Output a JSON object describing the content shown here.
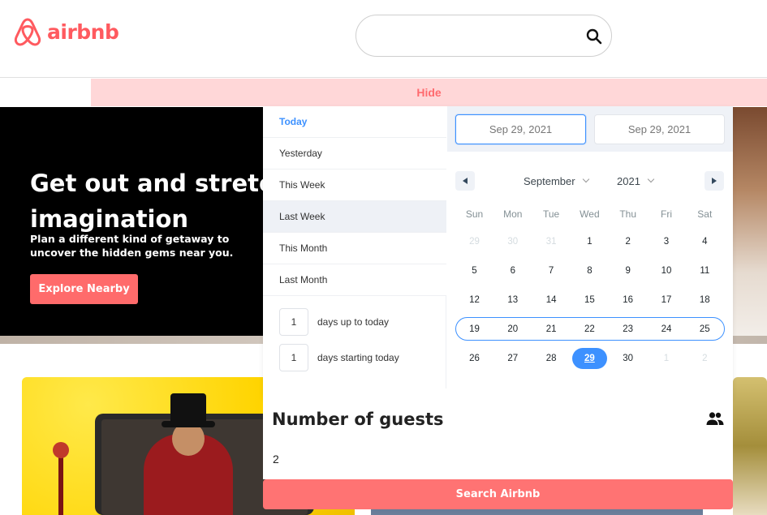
{
  "brand": {
    "name": "airbnb",
    "color": "#ff5a5f",
    "logo_icon": "airbnb-belo-icon"
  },
  "search": {
    "value": "",
    "icon": "search-icon"
  },
  "hide_bar": {
    "label": "Hide"
  },
  "hero": {
    "title": "Get out and stretch your imagination",
    "subtitle": "Plan a different kind of getaway to uncover the hidden gems near you.",
    "button_label": "Explore Nearby"
  },
  "datepicker": {
    "static_ranges": [
      "Today",
      "Yesterday",
      "This Week",
      "Last Week",
      "This Month",
      "Last Month"
    ],
    "active_range": "Today",
    "hovered_range": "Last Week",
    "input_ranges": [
      {
        "value": "1",
        "label": "days up to today"
      },
      {
        "value": "1",
        "label": "days starting today"
      }
    ],
    "start_date": "Sep 29, 2021",
    "end_date": "Sep 29, 2021",
    "month": "September",
    "year": "2021",
    "weekdays": [
      "Sun",
      "Mon",
      "Tue",
      "Wed",
      "Thu",
      "Fri",
      "Sat"
    ],
    "weeks": [
      [
        "29",
        "30",
        "31",
        "1",
        "2",
        "3",
        "4"
      ],
      [
        "5",
        "6",
        "7",
        "8",
        "9",
        "10",
        "11"
      ],
      [
        "12",
        "13",
        "14",
        "15",
        "16",
        "17",
        "18"
      ],
      [
        "19",
        "20",
        "21",
        "22",
        "23",
        "24",
        "25"
      ],
      [
        "26",
        "27",
        "28",
        "29",
        "30",
        "1",
        "2"
      ]
    ],
    "selected_day": "29",
    "accent_color": "#3d91ff"
  },
  "guests": {
    "title": "Number of guests",
    "icon": "people-icon",
    "value": "2"
  },
  "search_button": {
    "label": "Search Airbnb",
    "color": "#ff7373"
  }
}
